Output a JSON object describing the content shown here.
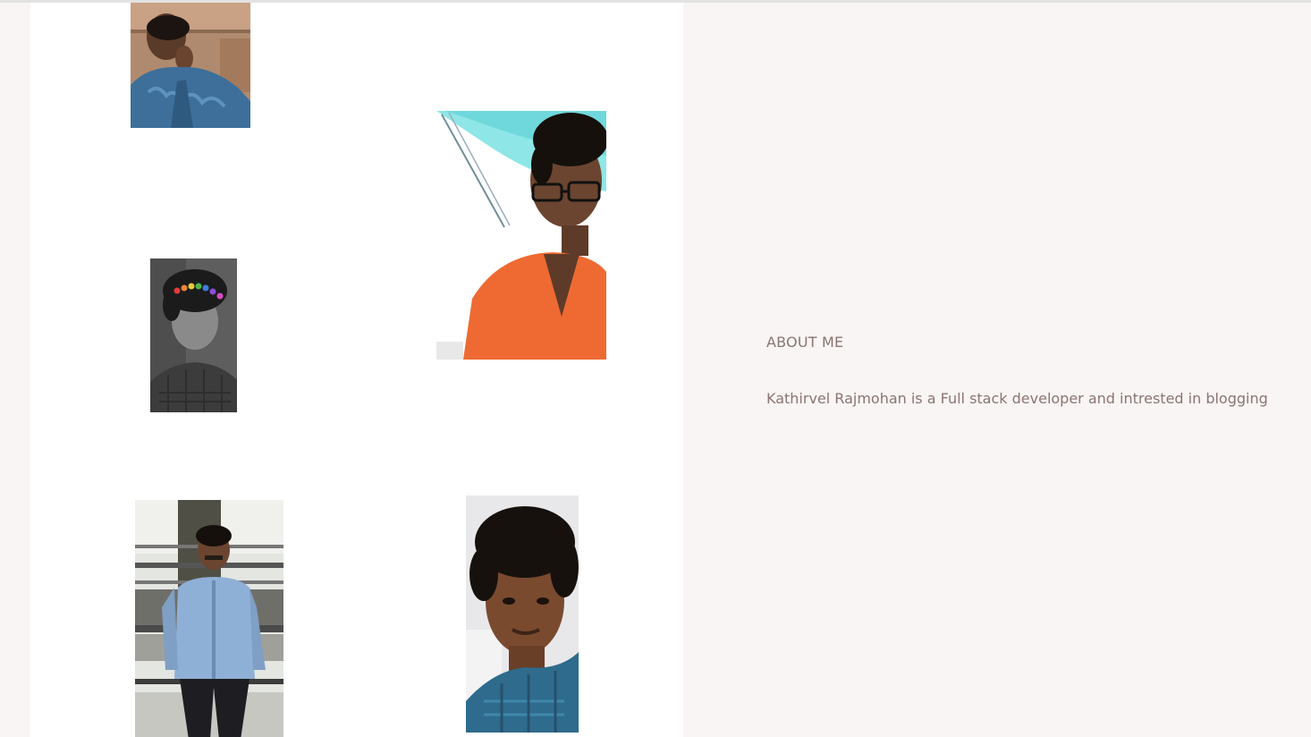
{
  "about": {
    "heading": "ABOUT ME",
    "text": "Kathirvel Rajmohan is a Full stack developer and intrested in blogging"
  },
  "gallery": {
    "photos": [
      {
        "name": "photo-portrait-thinking",
        "theme": "blue shirt, hand on chin"
      },
      {
        "name": "photo-portrait-glasses-orange",
        "theme": "orange shirt, glasses, looking up"
      },
      {
        "name": "photo-portrait-grayscale-hearts",
        "theme": "grayscale with heart crown"
      },
      {
        "name": "photo-portrait-standing-denim",
        "theme": "denim shirt, standing outdoors"
      },
      {
        "name": "photo-portrait-closeup-curly",
        "theme": "curly hair, blue shirt close-up"
      }
    ]
  },
  "colors": {
    "page_bg": "#f8f5f4",
    "gallery_bg": "#ffffff",
    "text": "#8b7472"
  }
}
